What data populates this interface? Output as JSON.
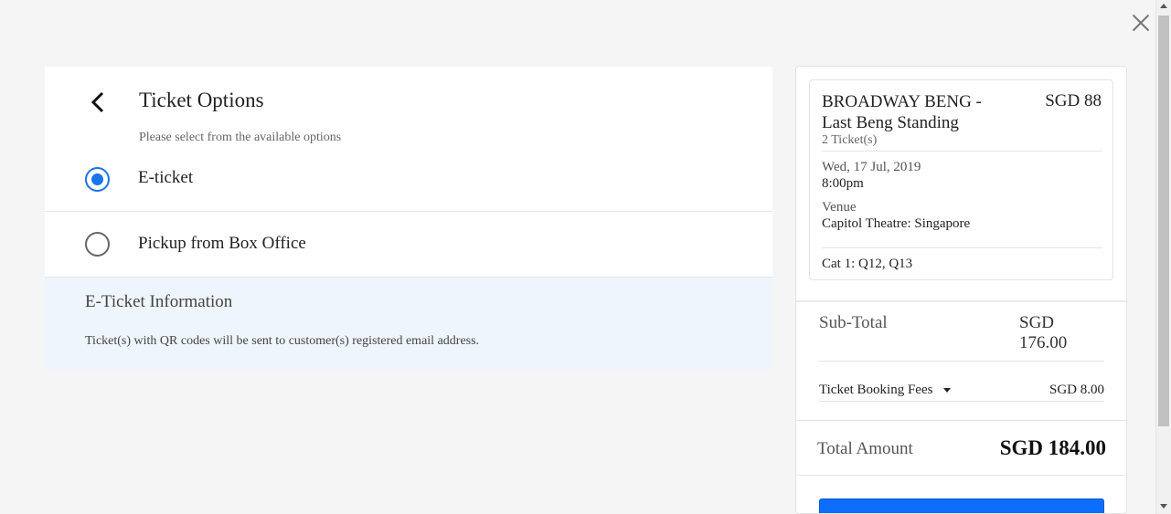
{
  "header": {
    "title": "Ticket Options",
    "subtitle": "Please select from the available options"
  },
  "options": [
    {
      "label": "E-ticket",
      "selected": true
    },
    {
      "label": "Pickup from Box Office",
      "selected": false
    }
  ],
  "info": {
    "title": "E-Ticket Information",
    "text": "Ticket(s) with QR codes will be sent to customer(s) registered email address."
  },
  "summary": {
    "event_title": "BROADWAY BENG - Last Beng Standing",
    "price": "SGD 88",
    "ticket_count": "2 Ticket(s)",
    "date": "Wed, 17 Jul, 2019",
    "time": "8:00pm",
    "venue_label": "Venue",
    "venue": "Capitol Theatre: Singapore",
    "seats": "Cat 1: Q12, Q13",
    "subtotal_label": "Sub-Total",
    "subtotal_value": "SGD 176.00",
    "fees_label": "Ticket Booking Fees",
    "fees_value": "SGD 8.00",
    "total_label": "Total Amount",
    "total_value": "SGD 184.00"
  },
  "colors": {
    "accent": "#1a73e8",
    "button": "#0d6efd",
    "info_bg": "#eff5fc"
  },
  "icons": {
    "close": "close-icon",
    "back": "chevron-left-icon",
    "caret": "caret-down-icon"
  }
}
